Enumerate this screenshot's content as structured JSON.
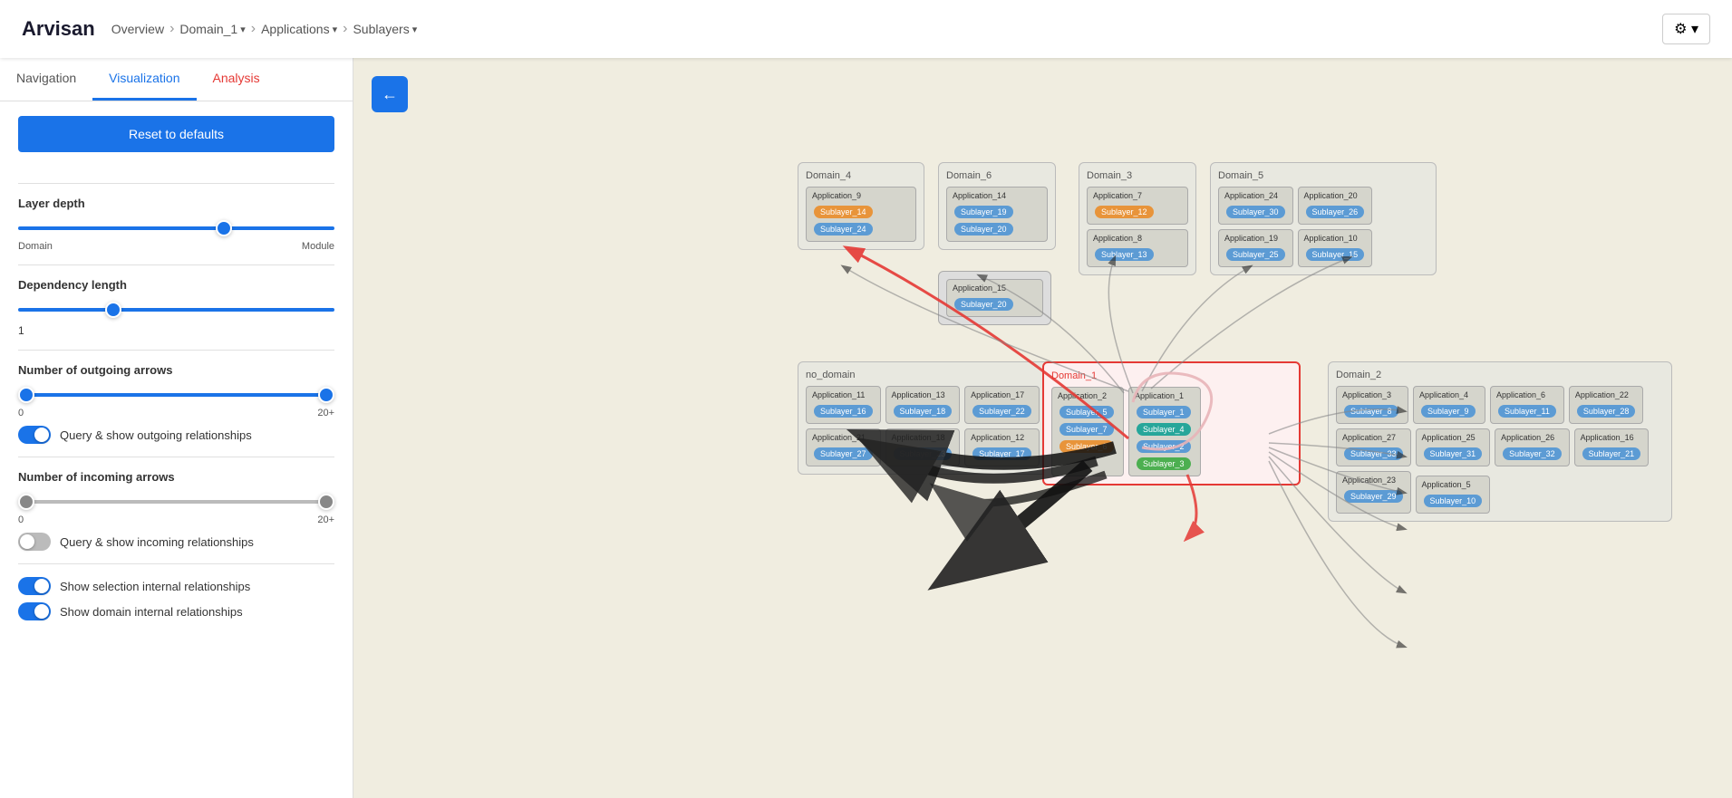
{
  "navbar": {
    "brand": "Arvisan",
    "breadcrumbs": [
      {
        "label": "Overview",
        "type": "link"
      },
      {
        "label": "Domain_1",
        "type": "dropdown"
      },
      {
        "label": "Applications",
        "type": "dropdown"
      },
      {
        "label": "Sublayers",
        "type": "dropdown"
      }
    ],
    "gear_label": "⚙"
  },
  "tabs": [
    {
      "label": "Navigation",
      "active": false
    },
    {
      "label": "Visualization",
      "active": true
    },
    {
      "label": "Analysis",
      "active": false
    }
  ],
  "panel": {
    "reset_label": "Reset to defaults",
    "layer_depth": {
      "title": "Layer depth",
      "min_label": "Domain",
      "max_label": "Module",
      "thumb_pct": 65
    },
    "dependency_length": {
      "title": "Dependency length",
      "value": "1",
      "thumb_pct": 30
    },
    "outgoing_arrows": {
      "title": "Number of outgoing arrows",
      "min_label": "0",
      "max_label": "20+",
      "left_pct": 0,
      "right_pct": 100,
      "toggle_label": "Query & show outgoing relationships",
      "toggle_on": true
    },
    "incoming_arrows": {
      "title": "Number of incoming arrows",
      "min_label": "0",
      "max_label": "20+",
      "left_pct": 0,
      "right_pct": 100,
      "toggle_label": "Query & show incoming relationships",
      "toggle_on": false
    },
    "show_selection": {
      "label": "Show selection internal relationships",
      "on": true
    },
    "show_domain": {
      "label": "Show domain internal relationships",
      "on": true
    }
  },
  "back_btn": "←",
  "graph": {
    "domains": [
      {
        "id": "domain4",
        "label": "Domain_4",
        "apps": [
          {
            "name": "Application_9",
            "sublayers": [
              {
                "label": "Sublayer_14",
                "color": "orange"
              },
              {
                "label": "Sublayer_24",
                "color": "blue"
              }
            ]
          }
        ]
      },
      {
        "id": "domain6",
        "label": "Domain_6",
        "apps": [
          {
            "name": "Application_14",
            "sublayers": [
              {
                "label": "Sublayer_19",
                "color": "blue"
              },
              {
                "label": "Sublayer_20",
                "color": "blue"
              }
            ]
          }
        ]
      },
      {
        "id": "domain3",
        "label": "Domain_3",
        "apps": [
          {
            "name": "Application_7",
            "sublayers": [
              {
                "label": "Sublayer_12",
                "color": "orange"
              }
            ]
          },
          {
            "name": "Application_8",
            "sublayers": [
              {
                "label": "Sublayer_13",
                "color": "blue"
              }
            ]
          }
        ]
      },
      {
        "id": "domain5",
        "label": "Domain_5",
        "apps": [
          {
            "name": "Application_24",
            "sublayers": [
              {
                "label": "Sublayer_30",
                "color": "blue"
              }
            ]
          },
          {
            "name": "Application_20",
            "sublayers": [
              {
                "label": "Sublayer_26",
                "color": "blue"
              }
            ]
          },
          {
            "name": "Application_19",
            "sublayers": [
              {
                "label": "Sublayer_25",
                "color": "blue"
              }
            ]
          },
          {
            "name": "Application_10",
            "sublayers": [
              {
                "label": "Sublayer_15",
                "color": "blue"
              }
            ]
          }
        ]
      },
      {
        "id": "nodomain",
        "label": "no_domain",
        "apps": [
          {
            "name": "Application_11",
            "sublayers": [
              {
                "label": "Sublayer_16",
                "color": "blue"
              }
            ]
          },
          {
            "name": "Application_13",
            "sublayers": [
              {
                "label": "Sublayer_18",
                "color": "blue"
              }
            ]
          },
          {
            "name": "Application_17",
            "sublayers": [
              {
                "label": "Sublayer_22",
                "color": "blue"
              }
            ]
          },
          {
            "name": "Application_21",
            "sublayers": [
              {
                "label": "Sublayer_27",
                "color": "blue"
              }
            ]
          },
          {
            "name": "Application_18",
            "sublayers": [
              {
                "label": "Sublayer_23",
                "color": "blue"
              }
            ]
          },
          {
            "name": "Application_12",
            "sublayers": [
              {
                "label": "Sublayer_17",
                "color": "blue"
              }
            ]
          }
        ]
      },
      {
        "id": "domain1",
        "label": "Domain_1",
        "selected": true,
        "apps": [
          {
            "name": "Application_2",
            "sublayers": [
              {
                "label": "Sublayer_5",
                "color": "blue"
              },
              {
                "label": "Sublayer_7",
                "color": "blue"
              },
              {
                "label": "Sublayer_6",
                "color": "orange"
              }
            ]
          },
          {
            "name": "Application_1",
            "sublayers": [
              {
                "label": "Sublayer_1",
                "color": "blue"
              },
              {
                "label": "Sublayer_4",
                "color": "teal"
              },
              {
                "label": "Sublayer_2",
                "color": "blue"
              },
              {
                "label": "Sublayer_3",
                "color": "green"
              }
            ]
          }
        ]
      },
      {
        "id": "application15",
        "label": "",
        "apps": [
          {
            "name": "Application_15",
            "sublayers": [
              {
                "label": "Sublayer_20",
                "color": "blue"
              }
            ]
          }
        ]
      },
      {
        "id": "domain2",
        "label": "Domain_2",
        "apps": [
          {
            "name": "Application_3",
            "sublayers": [
              {
                "label": "Sublayer_8",
                "color": "blue"
              }
            ]
          },
          {
            "name": "Application_4",
            "sublayers": [
              {
                "label": "Sublayer_9",
                "color": "blue"
              }
            ]
          },
          {
            "name": "Application_6",
            "sublayers": [
              {
                "label": "Sublayer_11",
                "color": "blue"
              }
            ]
          },
          {
            "name": "Application_22",
            "sublayers": [
              {
                "label": "Sublayer_28",
                "color": "blue"
              }
            ]
          },
          {
            "name": "Application_27",
            "sublayers": [
              {
                "label": "Sublayer_33",
                "color": "blue"
              }
            ]
          },
          {
            "name": "Application_25",
            "sublayers": [
              {
                "label": "Sublayer_31",
                "color": "blue"
              }
            ]
          },
          {
            "name": "Application_26",
            "sublayers": [
              {
                "label": "Sublayer_32",
                "color": "blue"
              }
            ]
          },
          {
            "name": "Application_16",
            "sublayers": [
              {
                "label": "Sublayer_21",
                "color": "blue"
              }
            ]
          },
          {
            "name": "Application_23",
            "sublayers": [
              {
                "label": "Sublayer_29",
                "color": "blue"
              }
            ]
          },
          {
            "name": "Application_5",
            "sublayers": [
              {
                "label": "Sublayer_10",
                "color": "blue"
              }
            ]
          }
        ]
      }
    ]
  }
}
